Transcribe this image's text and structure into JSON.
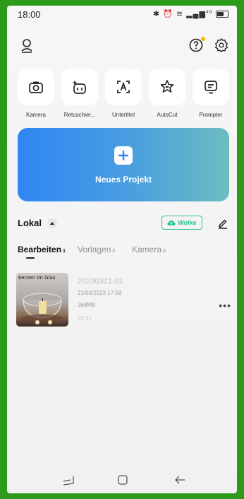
{
  "status_bar": {
    "time": "18:00",
    "network": "4G"
  },
  "tools": [
    {
      "label": "Kamera",
      "icon": "camera-icon"
    },
    {
      "label": "Retuschier...",
      "icon": "retouch-icon"
    },
    {
      "label": "Untertitel",
      "icon": "subtitle-icon"
    },
    {
      "label": "AutoCut",
      "icon": "autocut-icon"
    },
    {
      "label": "Prompter",
      "icon": "prompter-icon"
    }
  ],
  "new_project": {
    "label": "Neues Projekt"
  },
  "local": {
    "title": "Lokal",
    "cloud_button": "Wolke",
    "tabs": [
      {
        "label": "Bearbeiten",
        "count": "1",
        "active": true
      },
      {
        "label": "Vorlagen",
        "count": "0",
        "active": false
      },
      {
        "label": "Kamera",
        "count": "0",
        "active": false
      }
    ]
  },
  "projects": [
    {
      "thumbnail_caption": "Kerzen im Glas",
      "name": "20230321-01",
      "date": "21/03/2023 17:58",
      "size": "368MB",
      "duration": "00:31"
    }
  ],
  "colors": {
    "accent_green": "#2bbf8c",
    "card_start": "#2f86f4",
    "card_end": "#6cbdbf",
    "frame": "#2e9a1c"
  }
}
